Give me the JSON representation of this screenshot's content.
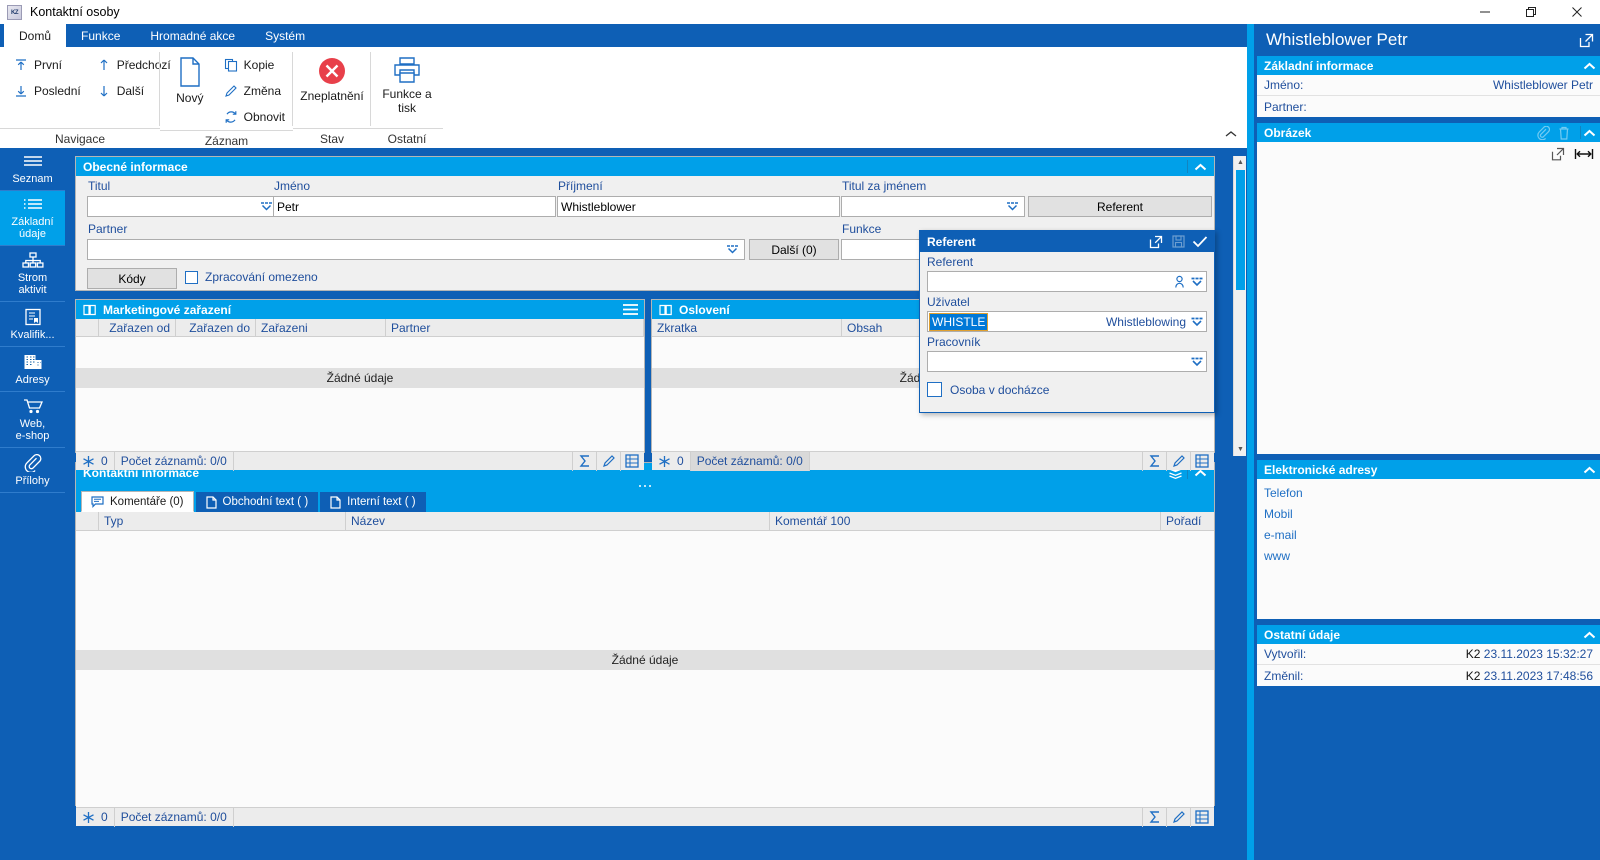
{
  "window": {
    "title": "Kontaktní osoby",
    "icon": "kz-app-icon",
    "minimize": "minimize-icon",
    "restore": "restore-icon",
    "close": "close-icon"
  },
  "ribbon": {
    "tabs": [
      {
        "label": "Domů",
        "active": true
      },
      {
        "label": "Funkce",
        "active": false
      },
      {
        "label": "Hromadné akce",
        "active": false
      },
      {
        "label": "Systém",
        "active": false
      }
    ],
    "groups": [
      {
        "label": "Navigace",
        "small_items": [
          {
            "label": "První",
            "icon": "arrow-up-to-line-icon"
          },
          {
            "label": "Poslední",
            "icon": "arrow-down-to-line-icon"
          },
          {
            "label": "Předchozí",
            "icon": "arrow-up-icon"
          },
          {
            "label": "Další",
            "icon": "arrow-down-icon"
          }
        ]
      },
      {
        "label": "Záznam",
        "big_items": [
          {
            "label": "Nový",
            "icon": "new-document-icon"
          }
        ],
        "small_items": [
          {
            "label": "Kopie",
            "icon": "copy-icon"
          },
          {
            "label": "Změna",
            "icon": "pencil-icon"
          },
          {
            "label": "Obnovit",
            "icon": "refresh-icon"
          }
        ]
      },
      {
        "label": "Stav",
        "big_items": [
          {
            "label": "Zneplatnění",
            "icon": "invalidate-circle-x-icon"
          }
        ]
      },
      {
        "label": "Ostatní",
        "big_items": [
          {
            "label": "Funkce a tisk",
            "icon": "printer-icon"
          }
        ]
      }
    ],
    "collapse_icon": "chevron-up-icon"
  },
  "leftnav": [
    {
      "label": "Seznam",
      "icon": "list-lines-icon",
      "active": false
    },
    {
      "label": "Základní údaje",
      "icon": "detail-list-icon",
      "active": true
    },
    {
      "label": "Strom aktivit",
      "icon": "hierarchy-tree-icon",
      "active": false
    },
    {
      "label": "Kvalifik...",
      "icon": "certificate-icon",
      "active": false
    },
    {
      "label": "Adresy",
      "icon": "building-icon",
      "active": false
    },
    {
      "label": "Web, e-shop",
      "icon": "shopping-cart-icon",
      "active": false
    },
    {
      "label": "Přílohy",
      "icon": "paperclip-icon",
      "active": false
    }
  ],
  "general_info": {
    "title": "Obecné informace",
    "collapse_icon": "chevron-up-icon",
    "fields": {
      "titul_label": "Titul",
      "titul_value": "",
      "jmeno_label": "Jméno",
      "jmeno_value": "Petr",
      "prijmeni_label": "Příjmení",
      "prijmeni_value": "Whistleblower",
      "titul_za_jmenem_label": "Titul za jménem",
      "titul_za_jmenem_value": "",
      "referent_button": "Referent",
      "partner_label": "Partner",
      "partner_value": "",
      "dalsi_button": "Další (0)",
      "funkce_label": "Funkce",
      "funkce_value": "",
      "kody_button": "Kódy",
      "zpracovani_omezeno_label": "Zpracování omezeno",
      "zpracovani_omezeno_checked": false
    }
  },
  "referent_popup": {
    "title": "Referent",
    "open_icon": "open-external-icon",
    "save_icon": "save-disk-icon",
    "confirm_icon": "check-icon",
    "referent_label": "Referent",
    "referent_value": "",
    "referent_person_icon": "person-icon",
    "uzivatel_label": "Uživatel",
    "uzivatel_code": "WHISTLE",
    "uzivatel_name": "Whistleblowing",
    "pracovnik_label": "Pracovník",
    "pracovnik_value": "",
    "osoba_v_dochazce_label": "Osoba v docházce",
    "osoba_v_dochazce_checked": false,
    "dropdown_icon": "dropdown-icon"
  },
  "marketing_panel": {
    "title": "Marketingové zařazení",
    "title_icon": "book-icon",
    "menu_icon": "hamburger-menu-icon",
    "columns": [
      "",
      "Zařazen od",
      "Zařazen do",
      "Zařazeni",
      "Partner"
    ],
    "no_data": "Žádné údaje",
    "footer": {
      "filter_icon": "snowflake-filter-icon",
      "filter_count": "0",
      "count_label": "Počet záznamů: 0/0",
      "sum_icon": "sigma-icon",
      "edit_icon": "pencil-icon",
      "report_icon": "grid-report-icon"
    }
  },
  "oslo_panel": {
    "title": "Oslovení",
    "title_icon": "book-icon",
    "columns": [
      "Zkratka",
      "Obsah"
    ],
    "no_data": "Žádné údaje",
    "footer": {
      "filter_icon": "snowflake-filter-icon",
      "filter_count": "0",
      "count_label": "Počet záznamů: 0/0",
      "sum_icon": "sigma-icon",
      "edit_icon": "pencil-icon",
      "report_icon": "grid-report-icon"
    }
  },
  "contact_panel": {
    "title": "Kontaktní informace",
    "layers_icon": "layers-icon",
    "collapse_icon": "chevron-up-icon",
    "tabs": [
      {
        "label": "Komentáře (0)",
        "icon": "comment-icon",
        "active": true
      },
      {
        "label": "Obchodní text ( )",
        "icon": "document-icon",
        "active": false
      },
      {
        "label": "Interní text ( )",
        "icon": "document-icon",
        "active": false
      }
    ],
    "columns": [
      "",
      "Typ",
      "Název",
      "Komentář 100",
      "Pořadí"
    ],
    "no_data": "Žádné údaje",
    "footer": {
      "filter_icon": "snowflake-filter-icon",
      "filter_count": "0",
      "count_label": "Počet záznamů: 0/0",
      "sum_icon": "sigma-icon",
      "edit_icon": "pencil-icon",
      "report_icon": "grid-report-icon"
    }
  },
  "rightbar": {
    "title": "Whistleblower Petr",
    "expand_icon": "open-external-icon",
    "basic": {
      "title": "Základní informace",
      "collapse_icon": "chevron-up-icon",
      "rows": [
        {
          "key": "Jméno:",
          "value": "Whistleblower Petr"
        },
        {
          "key": "Partner:",
          "value": ""
        }
      ]
    },
    "image": {
      "title": "Obrázek",
      "attach_icon": "paperclip-icon",
      "delete_icon": "trash-icon",
      "collapse_icon": "chevron-up-icon",
      "tool_open_icon": "open-external-icon",
      "tool_fit_icon": "fit-width-icon"
    },
    "eaddresses": {
      "title": "Elektronické adresy",
      "collapse_icon": "chevron-up-icon",
      "items": [
        "Telefon",
        "Mobil",
        "e-mail",
        "www"
      ]
    },
    "other": {
      "title": "Ostatní údaje",
      "collapse_icon": "chevron-up-icon",
      "rows": [
        {
          "key": "Vytvořil:",
          "user": "K2",
          "value": "23.11.2023 15:32:27"
        },
        {
          "key": "Změnil:",
          "user": "K2",
          "value": "23.11.2023 17:48:56"
        }
      ]
    }
  },
  "colors": {
    "brand_blue": "#0e5fb5",
    "accent_cyan": "#00a0e9",
    "label_blue": "#1f4e9c",
    "selection_blue": "#0078d7"
  }
}
